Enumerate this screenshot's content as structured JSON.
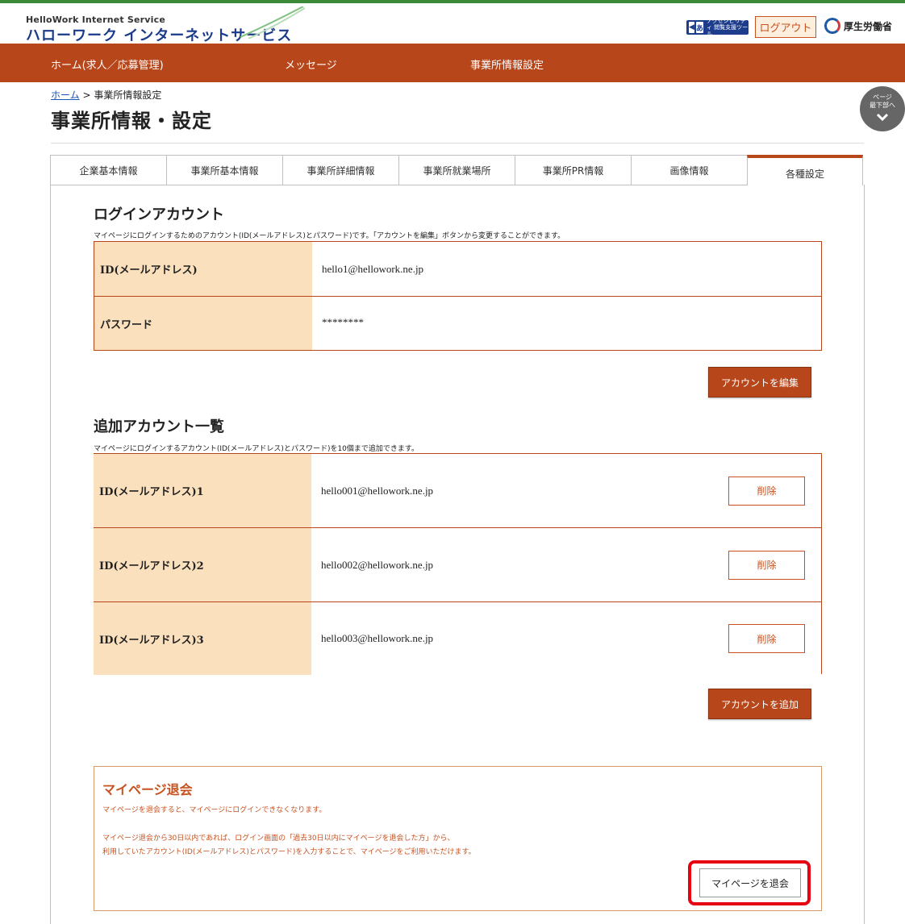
{
  "header": {
    "logo_sub": "HelloWork Internet Service",
    "logo_main": "ハローワーク インターネットサービス",
    "accessibility_label": "アクセシビリティ 閲覧支援ツール",
    "logout_label": "ログアウト",
    "ministry_name": "厚生労働省"
  },
  "nav": {
    "items": [
      {
        "label": "ホーム(求人／応募管理)"
      },
      {
        "label": "メッセージ"
      },
      {
        "label": "事業所情報設定"
      }
    ]
  },
  "breadcrumb": {
    "home": "ホーム",
    "separator": " > ",
    "current": "事業所情報設定"
  },
  "page_title": "事業所情報・設定",
  "page_bottom": {
    "line1": "ページ",
    "line2": "最下部へ",
    "chevron": "⌄"
  },
  "tabs": [
    {
      "label": "企業基本情報"
    },
    {
      "label": "事業所基本情報"
    },
    {
      "label": "事業所詳細情報"
    },
    {
      "label": "事業所就業場所"
    },
    {
      "label": "事業所PR情報"
    },
    {
      "label": "画像情報"
    },
    {
      "label": "各種設定",
      "active": true
    }
  ],
  "login_account": {
    "title": "ログインアカウント",
    "note": "マイページにログインするためのアカウント(ID(メールアドレス)とパスワード)です。「アカウントを編集」ボタンから変更することができます。",
    "rows": [
      {
        "label": "ID(メールアドレス)",
        "value": "hello1@hellowork.ne.jp"
      },
      {
        "label": "パスワード",
        "value": "********"
      }
    ],
    "edit_button": "アカウントを編集"
  },
  "additional_accounts": {
    "title": "追加アカウント一覧",
    "note": "マイページにログインするアカウント(ID(メールアドレス)とパスワード)を10個まで追加できます。",
    "rows": [
      {
        "label": "ID(メールアドレス)1",
        "value": "hello001@hellowork.ne.jp",
        "delete": "削除"
      },
      {
        "label": "ID(メールアドレス)2",
        "value": "hello002@hellowork.ne.jp",
        "delete": "削除"
      },
      {
        "label": "ID(メールアドレス)3",
        "value": "hello003@hellowork.ne.jp",
        "delete": "削除"
      }
    ],
    "add_button": "アカウントを追加"
  },
  "withdraw": {
    "title": "マイページ退会",
    "p1": "マイページを退会すると、マイページにログインできなくなります。",
    "p2": "マイページ退会から30日以内であれば、ログイン画面の「過去30日以内にマイページを退会した方」から、",
    "p3": "利用していたアカウント(ID(メールアドレス)とパスワード)を入力することで、マイページをご利用いただけます。",
    "button": "マイページを退会"
  },
  "colors": {
    "accent": "#b8461b",
    "header_green": "#3a8a3a",
    "label_bg": "#fbe0bd",
    "highlight": "#e60012"
  }
}
